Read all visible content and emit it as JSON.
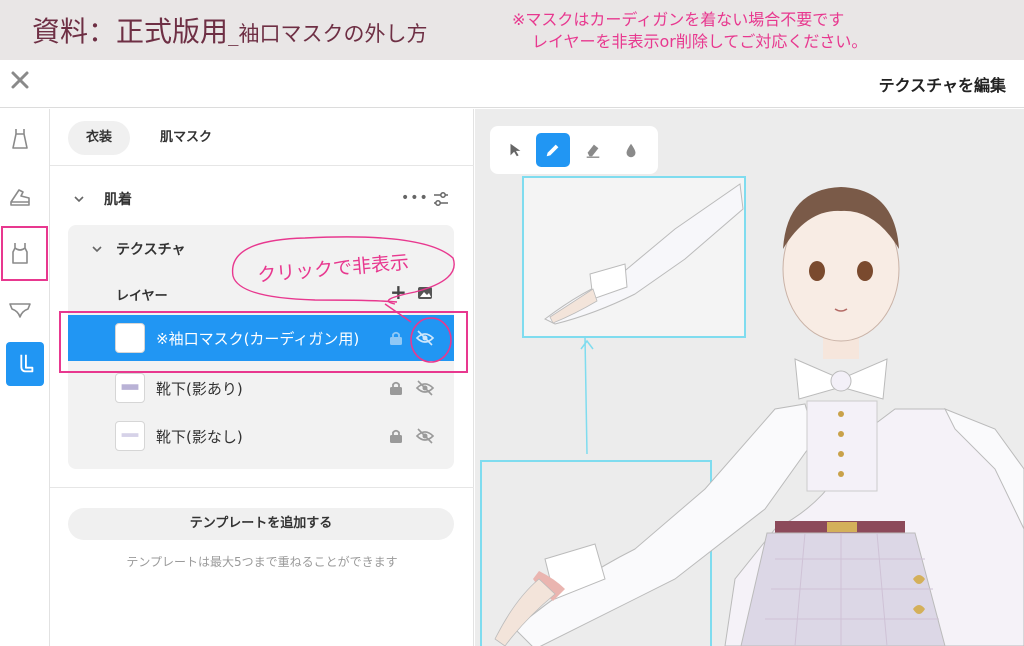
{
  "banner": {
    "title_main": "資料：正式版用",
    "title_sub": "_袖口マスクの外し方",
    "note_line1": "※マスクはカーディガンを着ない場合不要です",
    "note_line2": "レイヤーを非表示or削除してご対応ください。",
    "accent_color": "#e8388f",
    "title_color": "#6e2f44"
  },
  "topbar": {
    "close_icon": "close-icon",
    "title": "テクスチャを編集"
  },
  "rail": {
    "items": [
      "dress-icon",
      "shoe-icon",
      "tanktop-icon",
      "underwear-icon",
      "sock-icon"
    ],
    "active_index": 4
  },
  "panel": {
    "tabs": [
      {
        "label": "衣装"
      },
      {
        "label": "肌マスク"
      }
    ],
    "section": {
      "label": "肌着",
      "more_label": "•••"
    },
    "subsection": {
      "label": "テクスチャ",
      "layers_header": "レイヤー",
      "add_label": "+"
    },
    "layers": [
      {
        "name": "※袖口マスク(カーディガン用)",
        "selected": true
      },
      {
        "name": "靴下(影あり)",
        "selected": false
      },
      {
        "name": "靴下(影なし)",
        "selected": false
      }
    ],
    "annotation": "クリックで非表示",
    "add_template_label": "テンプレートを追加する",
    "template_note": "テンプレートは最大5つまで重ねることができます"
  },
  "toolbar": {
    "tools": [
      "select-icon",
      "pencil-icon",
      "eraser-icon",
      "fill-icon"
    ],
    "active_index": 1
  },
  "colors": {
    "selected_blue": "#2196f3",
    "highlight_cyan": "#7fdcef"
  }
}
